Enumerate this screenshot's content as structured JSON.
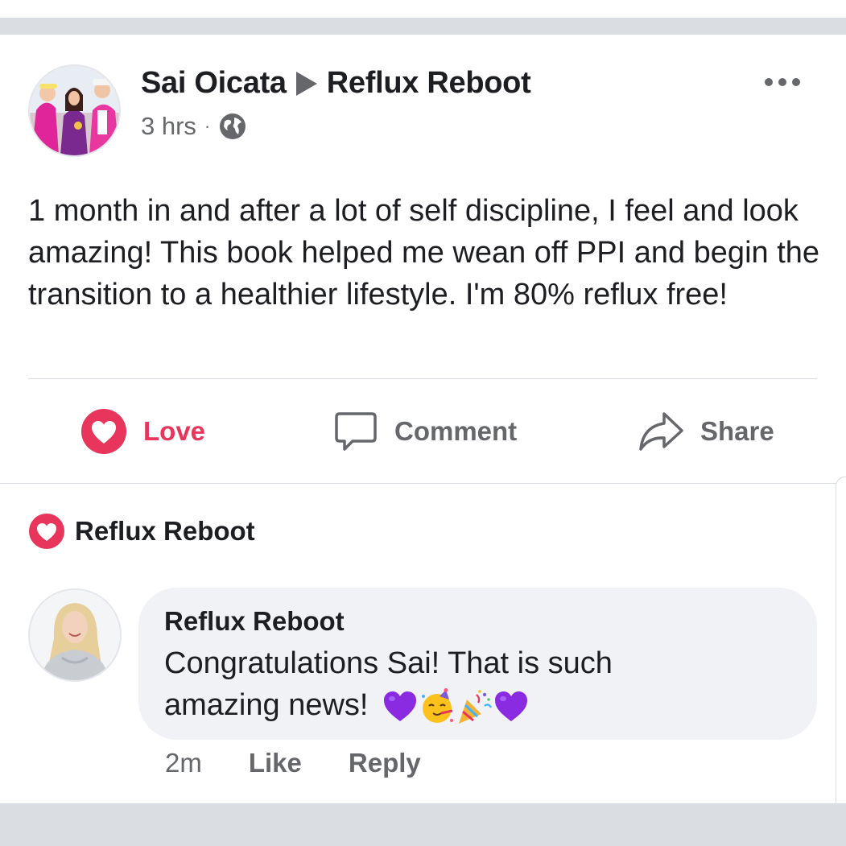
{
  "post": {
    "author": "Sai Oicata",
    "group": "Reflux Reboot",
    "time": "3 hrs",
    "separator": "·",
    "privacy_icon": "globe-icon",
    "more_icon": "more-horizontal-icon",
    "text": "1 month in and after a lot of self discipline, I feel and look amazing! This book helped me wean off PPI and begin the transition to a healthier lifestyle. I'm 80% reflux free!"
  },
  "actions": {
    "love_label": "Love",
    "comment_label": "Comment",
    "share_label": "Share"
  },
  "reactions": {
    "icon": "heart-reaction-icon",
    "name": "Reflux Reboot"
  },
  "comment": {
    "author": "Reflux Reboot",
    "text": "Congratulations Sai! That is such amazing news!",
    "emojis": [
      "purple-heart",
      "partying-face",
      "party-popper",
      "purple-heart"
    ],
    "time": "2m",
    "like_label": "Like",
    "reply_label": "Reply"
  },
  "colors": {
    "love_red": "#e8355b",
    "secondary_text": "#65676b",
    "bubble_bg": "#f0f2f5",
    "divider": "#dadde1",
    "purple_heart": "#8a2be2"
  }
}
